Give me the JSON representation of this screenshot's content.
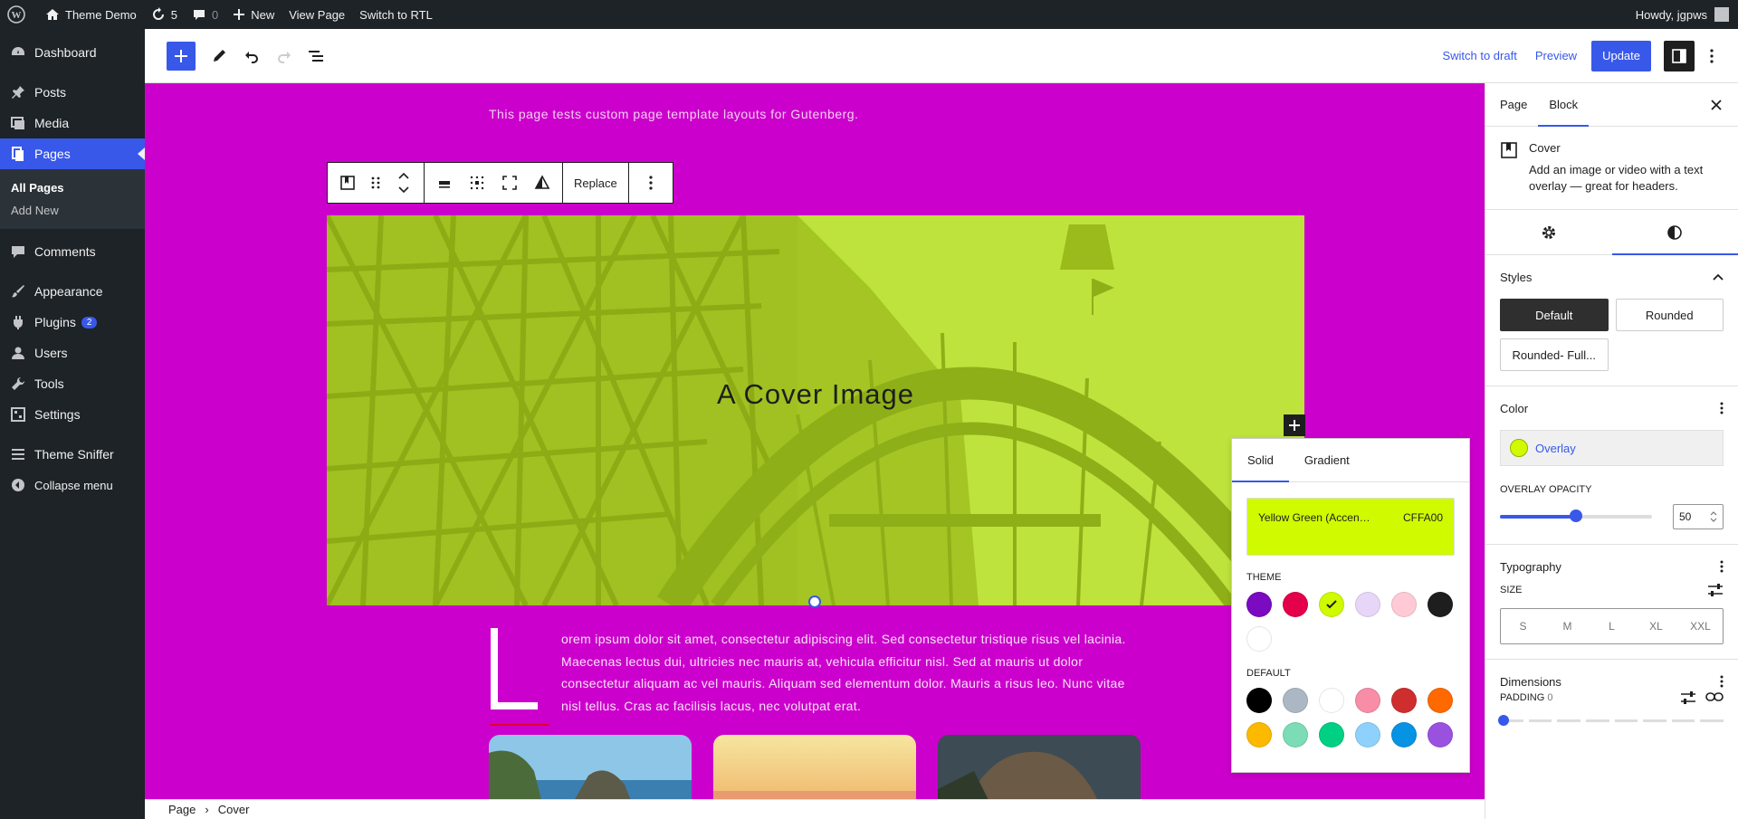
{
  "admin_bar": {
    "site_name": "Theme Demo",
    "updates_count": "5",
    "comments_count": "0",
    "new_label": "New",
    "view_page_label": "View Page",
    "rtl_label": "Switch to RTL",
    "howdy": "Howdy, jgpws"
  },
  "sidebar": {
    "items": [
      {
        "label": "Dashboard",
        "icon": "dashboard-icon"
      },
      {
        "label": "Posts",
        "icon": "pin-icon"
      },
      {
        "label": "Media",
        "icon": "media-icon"
      },
      {
        "label": "Pages",
        "icon": "pages-icon"
      },
      {
        "label": "Comments",
        "icon": "comment-icon"
      },
      {
        "label": "Appearance",
        "icon": "brush-icon"
      },
      {
        "label": "Plugins",
        "icon": "plugin-icon",
        "badge": "2"
      },
      {
        "label": "Users",
        "icon": "user-icon"
      },
      {
        "label": "Tools",
        "icon": "wrench-icon"
      },
      {
        "label": "Settings",
        "icon": "settings-icon"
      },
      {
        "label": "Theme Sniffer",
        "icon": "list-icon"
      },
      {
        "label": "Collapse menu",
        "icon": "collapse-icon"
      }
    ],
    "submenu": [
      "All Pages",
      "Add New"
    ]
  },
  "editor_toolbar": {
    "switch_to_draft": "Switch to draft",
    "preview": "Preview",
    "update": "Update"
  },
  "canvas": {
    "intro_text": "This page tests custom page template layouts for Gutenberg.",
    "cover_title": "A Cover Image",
    "dropcap_letter": "L",
    "paragraph": "orem ipsum dolor sit amet, consectetur adipiscing elit. Sed consectetur tristique risus vel lacinia. Maecenas lectus dui, ultricies nec mauris at, vehicula efficitur nisl. Sed at mauris ut dolor consectetur aliquam ac vel mauris. Aliquam sed elementum dolor. Mauris a risus leo. Nunc vitae nisl tellus. Cras ac facilisis lacus, nec volutpat erat."
  },
  "block_toolbar": {
    "replace_label": "Replace"
  },
  "color_popover": {
    "tabs": [
      "Solid",
      "Gradient"
    ],
    "selected_name": "Yellow Green (Accen…",
    "selected_hex": "CFFA00",
    "theme_label": "THEME",
    "default_label": "DEFAULT",
    "theme_colors": [
      "#7a0bc0",
      "#e4004b",
      "#cffa00",
      "#e7d6f7",
      "#ffcad6",
      "#1e1e1e",
      "#ffffff"
    ],
    "default_colors": [
      "#000000",
      "#abb8c3",
      "#ffffff",
      "#f78da7",
      "#cf2e2e",
      "#ff6900",
      "#fcb900",
      "#7bdcb5",
      "#00d084",
      "#8ed1fc",
      "#0693e3",
      "#9b51e0"
    ]
  },
  "breadcrumb": [
    "Page",
    "Cover"
  ],
  "panel": {
    "tabs": [
      "Page",
      "Block"
    ],
    "block_name": "Cover",
    "block_desc": "Add an image or video with a text overlay — great for headers.",
    "styles_title": "Styles",
    "styles": [
      "Default",
      "Rounded",
      "Rounded- Full..."
    ],
    "color_title": "Color",
    "overlay_label": "Overlay",
    "overlay_opacity_label": "OVERLAY OPACITY",
    "overlay_opacity_value": "50",
    "overlay_opacity_fraction": 0.5,
    "typography_title": "Typography",
    "size_label": "SIZE",
    "sizes": [
      "S",
      "M",
      "L",
      "XL",
      "XXL"
    ],
    "dimensions_title": "Dimensions",
    "padding_label": "PADDING",
    "padding_value": "0"
  },
  "colors": {
    "canvas_bg": "#cc00cc",
    "accent": "#3858e9",
    "overlay": "#cffa00"
  }
}
